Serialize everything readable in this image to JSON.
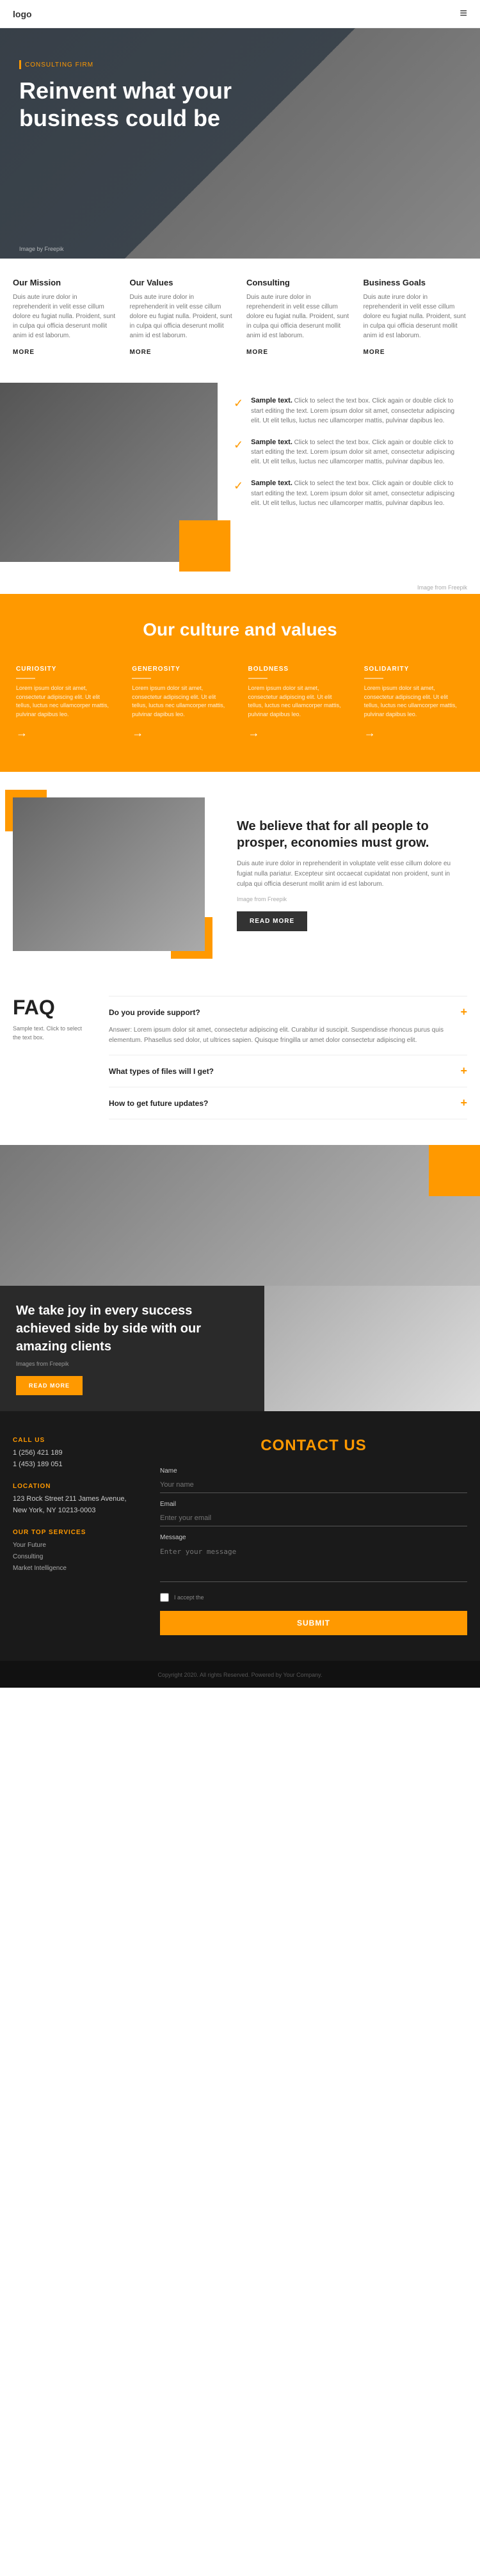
{
  "header": {
    "logo": "logo",
    "hamburger": "≡"
  },
  "hero": {
    "tag": "CONSULTING FIRM",
    "title": "Reinvent what your business could be",
    "credit": "Image by Freepik"
  },
  "info_cards": [
    {
      "title": "Our Mission",
      "text": "Duis aute irure dolor in reprehenderit in velit esse cillum dolore eu fugiat nulla. Proident, sunt in culpa qui officia deserunt mollit anim id est laborum.",
      "more": "MORE"
    },
    {
      "title": "Our Values",
      "text": "Duis aute irure dolor in reprehenderit in velit esse cillum dolore eu fugiat nulla. Proident, sunt in culpa qui officia deserunt mollit anim id est laborum.",
      "more": "MORE"
    },
    {
      "title": "Consulting",
      "text": "Duis aute irure dolor in reprehenderit in velit esse cillum dolore eu fugiat nulla. Proident, sunt in culpa qui officia deserunt mollit anim id est laborum.",
      "more": "MORE"
    },
    {
      "title": "Business Goals",
      "text": "Duis aute irure dolor in reprehenderit in velit esse cillum dolore eu fugiat nulla. Proident, sunt in culpa qui officia deserunt mollit anim id est laborum.",
      "more": "MORE"
    }
  ],
  "values": {
    "items": [
      {
        "strong": "Sample text.",
        "text": " Click to select the text box. Click again or double click to start editing the text. Lorem ipsum dolor sit amet, consectetur adipiscing elit. Ut elit tellus, luctus nec ullamcorper mattis, pulvinar dapibus leo."
      },
      {
        "strong": "Sample text.",
        "text": " Click to select the text box. Click again or double click to start editing the text. Lorem ipsum dolor sit amet, consectetur adipiscing elit. Ut elit tellus, luctus nec ullamcorper mattis, pulvinar dapibus leo."
      },
      {
        "strong": "Sample text.",
        "text": " Click to select the text box. Click again or double click to start editing the text. Lorem ipsum dolor sit amet, consectetur adipiscing elit. Ut elit tellus, luctus nec ullamcorper mattis, pulvinar dapibus leo."
      }
    ],
    "credit": "Image from Freepik"
  },
  "culture": {
    "title": "Our culture and values",
    "cards": [
      {
        "title": "CURIOSITY",
        "text": "Lorem ipsum dolor sit amet, consectetur adipiscing elit. Ut elit tellus, luctus nec ullamcorper mattis, pulvinar dapibus leo."
      },
      {
        "title": "GENEROSITY",
        "text": "Lorem ipsum dolor sit amet, consectetur adipiscing elit. Ut elit tellus, luctus nec ullamcorper mattis, pulvinar dapibus leo."
      },
      {
        "title": "BOLDNESS",
        "text": "Lorem ipsum dolor sit amet, consectetur adipiscing elit. Ut elit tellus, luctus nec ullamcorper mattis, pulvinar dapibus leo."
      },
      {
        "title": "SOLIDARITY",
        "text": "Lorem ipsum dolor sit amet, consectetur adipiscing elit. Ut elit tellus, luctus nec ullamcorper mattis, pulvinar dapibus leo."
      }
    ]
  },
  "believe": {
    "title": "We believe that for all people to prosper, economies must grow.",
    "text": "Duis aute irure dolor in reprehenderit in voluptate velit esse cillum dolore eu fugiat nulla pariatur. Excepteur sint occaecat cupidatat non proident, sunt in culpa qui officia deserunt mollit anim id est laborum.",
    "credit": "Image from Freepik",
    "button": "READ MORE"
  },
  "faq": {
    "title": "FAQ",
    "subtitle": "Sample text. Click to select the text box.",
    "items": [
      {
        "question": "Do you provide support?",
        "answer": "Answer: Lorem ipsum dolor sit amet, consectetur adipiscing elit. Curabitur id suscipit. Suspendisse rhoncus purus quis elementum. Phasellus sed dolor, ut ultrices sapien. Quisque fringilla ur amet dolor consectetur adipiscing elit."
      },
      {
        "question": "What types of files will I get?",
        "answer": ""
      },
      {
        "question": "How to get future updates?",
        "answer": ""
      }
    ]
  },
  "clients": {
    "title": "We take joy in every success achieved side by side with our amazing clients",
    "credit": "Images from Freepik",
    "button": "READ MORE"
  },
  "contact": {
    "form_title": "CONTACT US",
    "call": {
      "label": "CALL US",
      "lines": [
        "1 (256) 421 189",
        "1 (453) 189 051"
      ]
    },
    "location": {
      "label": "LOCATION",
      "lines": [
        "123 Rock Street 211 James Avenue,",
        "New York, NY 10213-0003"
      ]
    },
    "top_services": {
      "label": "OUR TOP SERVICES",
      "items": [
        "Your Future",
        "Consulting",
        "Market Intelligence"
      ]
    },
    "fields": {
      "name_label": "Name",
      "name_placeholder": "Your name",
      "email_label": "Email",
      "email_placeholder": "Enter your email",
      "message_label": "Message",
      "message_placeholder": "Enter your message",
      "checkbox_label": "I accept the",
      "submit": "SUBMIT"
    }
  },
  "footer": {
    "text": "Copyright 2020. All rights Reserved. Powered by Your Company."
  }
}
